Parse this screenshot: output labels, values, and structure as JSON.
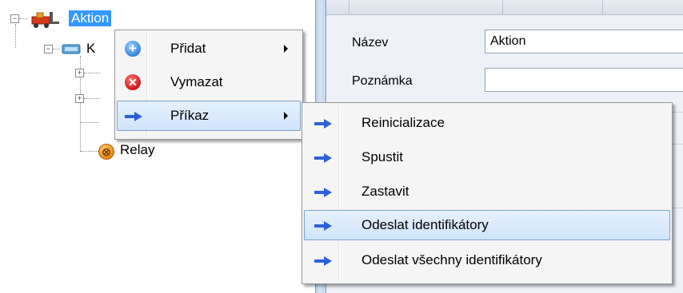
{
  "tree": {
    "root_label": "Aktion",
    "child_label_partial": "K",
    "relay_label": "Relay"
  },
  "form": {
    "name_label": "Název",
    "name_value": "Aktion",
    "note_label": "Poznámka",
    "note_value": ""
  },
  "context_menu": {
    "items": [
      {
        "label": "Přidat",
        "icon": "plus-circle-icon",
        "has_submenu": true
      },
      {
        "label": "Vymazat",
        "icon": "delete-x-icon",
        "has_submenu": false
      },
      {
        "label": "Příkaz",
        "icon": "arrow-right-icon",
        "has_submenu": true,
        "highlighted": true
      }
    ]
  },
  "submenu": {
    "items": [
      {
        "label": "Reinicializace",
        "icon": "arrow-right-icon"
      },
      {
        "label": "Spustit",
        "icon": "arrow-right-icon"
      },
      {
        "label": "Zastavit",
        "icon": "arrow-right-icon"
      },
      {
        "label": "Odeslat identifikátory",
        "icon": "arrow-right-icon",
        "highlighted": true
      },
      {
        "label": "Odeslat všechny identifikátory",
        "icon": "arrow-right-icon"
      }
    ]
  },
  "colors": {
    "selection_blue": "#3399ff",
    "menu_highlight_border": "#7da2ce",
    "arrow_blue": "#2f5fd8"
  }
}
